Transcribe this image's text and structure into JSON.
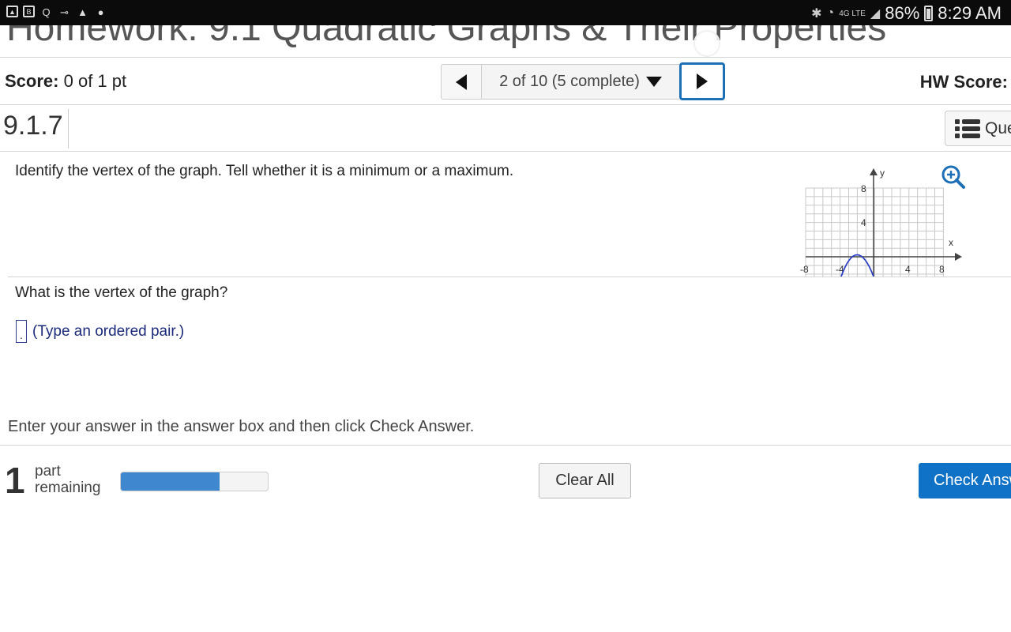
{
  "status_bar": {
    "left_icons": [
      "image-icon",
      "b-icon",
      "search-icon",
      "key-icon",
      "warning-icon",
      "alert-icon"
    ],
    "network": "4G LTE",
    "battery": "86%",
    "time": "8:29 AM"
  },
  "header": {
    "title": "Homework: 9.1 Quadratic Graphs & Their Properties"
  },
  "score_bar": {
    "score_label": "Score:",
    "score_value": "0 of 1 pt",
    "question_nav": "2 of 10 (5 complete)",
    "hw_score_label": "HW Score:"
  },
  "question_header": {
    "section": "9.1.7",
    "que_button": "Que"
  },
  "question": {
    "prompt": "Identify the vertex of the graph. Tell whether it is a minimum or a maximum.",
    "sub_prompt": "What is the vertex of the graph?",
    "answer_box_value": ".",
    "answer_hint": "(Type an ordered pair.)"
  },
  "instruction": "Enter your answer in the answer box and then click Check Answer.",
  "footer": {
    "parts_number": "1",
    "part_word": "part",
    "remaining_word": "remaining",
    "progress_fraction": 0.67,
    "clear_all": "Clear All",
    "check_answer": "Check Answer"
  },
  "graph": {
    "x_axis_label": "x",
    "y_axis_label": "y",
    "x_ticks": [
      "-8",
      "-4",
      "4",
      "8"
    ],
    "y_ticks": [
      "8",
      "4"
    ],
    "curve_color": "#2b3ec4"
  },
  "colors": {
    "accent": "#1d6fb6",
    "check_button": "#0f72c6",
    "progress": "#3f87cf",
    "hint_text": "#1b2a7a"
  }
}
